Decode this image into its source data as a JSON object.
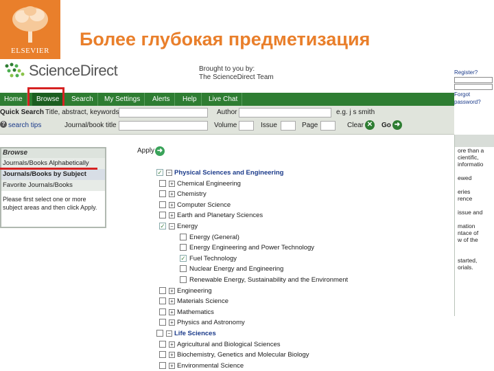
{
  "slide": {
    "title": "Более глубокая предметизация",
    "logo_text": "ELSEVIER"
  },
  "site": {
    "logo_text": "ScienceDirect",
    "brought_line1": "Brought to you by:",
    "brought_line2": "The ScienceDirect Team",
    "right_links": [
      "Register?",
      "Forgot password?"
    ]
  },
  "nav": {
    "items": [
      "Home",
      "Browse",
      "Search",
      "My Settings",
      "Alerts",
      "Help",
      "Live Chat"
    ],
    "active": "Browse"
  },
  "quick_search": {
    "label": "Quick Search",
    "field1_label": "Title, abstract, keywords",
    "author_label": "Author",
    "example": "e.g. j s smith",
    "search_tips": "search tips",
    "journal_label": "Journal/book title",
    "volume_label": "Volume",
    "issue_label": "Issue",
    "page_label": "Page",
    "clear_label": "Clear",
    "go_label": "Go"
  },
  "browse_panel": {
    "heading": "Browse",
    "items": [
      "Journals/Books Alphabetically",
      "Journals/Books by Subject",
      "Favorite Journals/Books"
    ],
    "note": "Please first select one or more subject areas and then click Apply."
  },
  "apply_label": "Apply",
  "tree": [
    {
      "label": "Physical Sciences and Engineering",
      "level": 0,
      "checked": true,
      "expanded": true
    },
    {
      "label": "Chemical Engineering",
      "level": 1,
      "checked": false,
      "expanded": false
    },
    {
      "label": "Chemistry",
      "level": 1,
      "checked": false,
      "expanded": false
    },
    {
      "label": "Computer Science",
      "level": 1,
      "checked": false,
      "expanded": false
    },
    {
      "label": "Earth and Planetary Sciences",
      "level": 1,
      "checked": false,
      "expanded": false
    },
    {
      "label": "Energy",
      "level": 1,
      "checked": true,
      "expanded": true
    },
    {
      "label": "Energy (General)",
      "level": 2,
      "checked": false
    },
    {
      "label": "Energy Engineering and Power Technology",
      "level": 2,
      "checked": false
    },
    {
      "label": "Fuel Technology",
      "level": 2,
      "checked": true
    },
    {
      "label": "Nuclear Energy and Engineering",
      "level": 2,
      "checked": false
    },
    {
      "label": "Renewable Energy, Sustainability and the Environment",
      "level": 2,
      "checked": false
    },
    {
      "label": "Engineering",
      "level": 1,
      "checked": false,
      "expanded": false
    },
    {
      "label": "Materials Science",
      "level": 1,
      "checked": false,
      "expanded": false
    },
    {
      "label": "Mathematics",
      "level": 1,
      "checked": false,
      "expanded": false
    },
    {
      "label": "Physics and Astronomy",
      "level": 1,
      "checked": false,
      "expanded": false
    },
    {
      "label": "Life Sciences",
      "level": 0,
      "checked": false,
      "expanded": true
    },
    {
      "label": "Agricultural and Biological Sciences",
      "level": 1,
      "checked": false,
      "expanded": false
    },
    {
      "label": "Biochemistry, Genetics and Molecular Biology",
      "level": 1,
      "checked": false,
      "expanded": false
    },
    {
      "label": "Environmental Science",
      "level": 1,
      "checked": false,
      "expanded": false
    }
  ],
  "right_fragments": [
    "ore than a",
    "cientific,",
    "informatio",
    "",
    "ewed",
    "",
    "eries",
    "rence",
    "",
    "issue and",
    "",
    "mation",
    "ntace of",
    "w of the",
    "",
    "",
    "started,",
    "orials."
  ]
}
